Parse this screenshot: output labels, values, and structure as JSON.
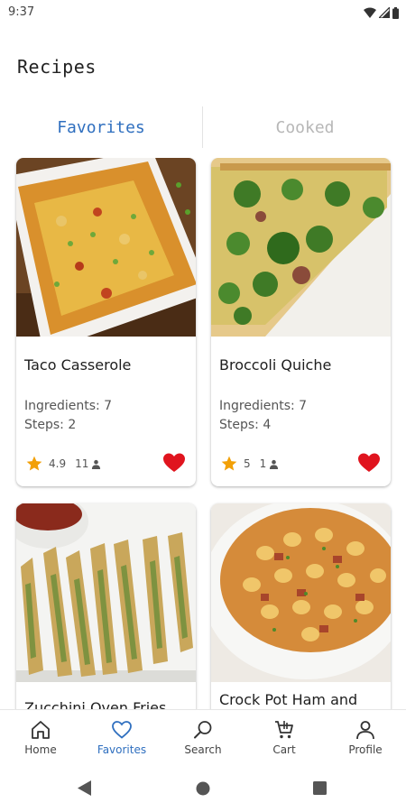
{
  "status": {
    "time": "9:37"
  },
  "page": {
    "title": "Recipes"
  },
  "tabs": [
    {
      "label": "Favorites",
      "active": true
    },
    {
      "label": "Cooked",
      "active": false
    }
  ],
  "recipes": [
    {
      "title": "Taco Casserole",
      "ingredients": "Ingredients: 7",
      "steps": "Steps: 2",
      "rating": "4.9",
      "ratings_count": "11",
      "favorite": true
    },
    {
      "title": "Broccoli Quiche",
      "ingredients": "Ingredients: 7",
      "steps": "Steps: 4",
      "rating": "5",
      "ratings_count": "1",
      "favorite": true
    },
    {
      "title": "Zucchini Oven Fries"
    },
    {
      "title": "Crock Pot Ham and"
    }
  ],
  "bottom_nav": [
    {
      "label": "Home",
      "icon": "home-icon",
      "active": false
    },
    {
      "label": "Favorites",
      "icon": "heart-outline-icon",
      "active": true
    },
    {
      "label": "Search",
      "icon": "search-icon",
      "active": false
    },
    {
      "label": "Cart",
      "icon": "cart-icon",
      "active": false
    },
    {
      "label": "Profile",
      "icon": "person-icon",
      "active": false
    }
  ],
  "colors": {
    "accent": "#2f6fbf",
    "favorite_heart": "#e0141e",
    "star": "#f2a007",
    "inactive_tab": "#b7b7b7"
  }
}
